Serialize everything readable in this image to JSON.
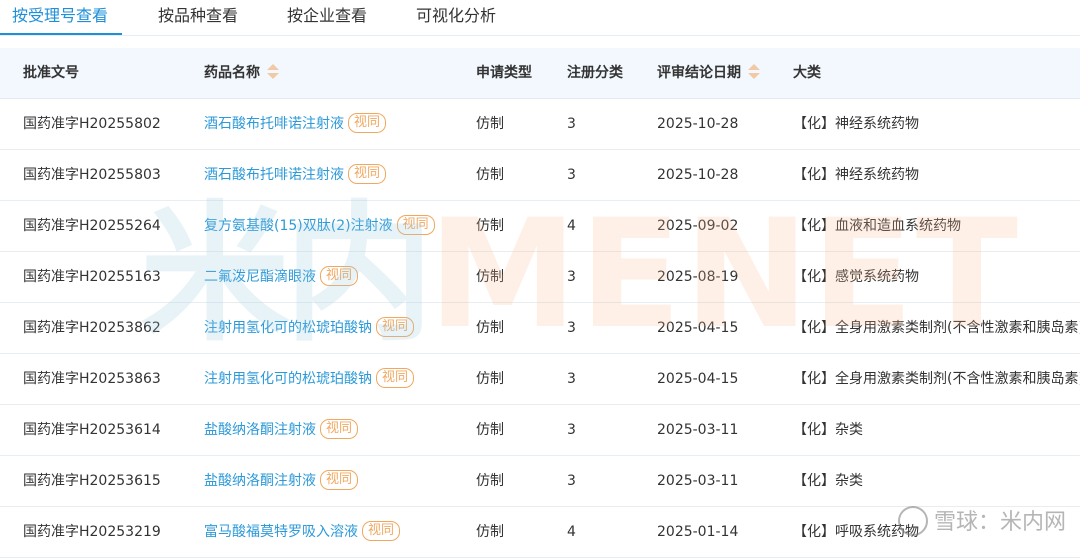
{
  "tabs": [
    {
      "label": "按受理号查看",
      "active": true
    },
    {
      "label": "按品种查看",
      "active": false
    },
    {
      "label": "按企业查看",
      "active": false
    },
    {
      "label": "可视化分析",
      "active": false
    }
  ],
  "table": {
    "headers": [
      "批准文号",
      "药品名称",
      "申请类型",
      "注册分类",
      "评审结论日期",
      "大类"
    ],
    "sortable_headers": [
      "药品名称",
      "评审结论日期"
    ],
    "badge_label": "视同",
    "rows": [
      {
        "approval_no": "国药准字H20255802",
        "drug_name": "酒石酸布托啡诺注射液",
        "app_type": "仿制",
        "reg_class": "3",
        "date": "2025-10-28",
        "category": "【化】神经系统药物"
      },
      {
        "approval_no": "国药准字H20255803",
        "drug_name": "酒石酸布托啡诺注射液",
        "app_type": "仿制",
        "reg_class": "3",
        "date": "2025-10-28",
        "category": "【化】神经系统药物"
      },
      {
        "approval_no": "国药准字H20255264",
        "drug_name": "复方氨基酸(15)双肽(2)注射液",
        "app_type": "仿制",
        "reg_class": "4",
        "date": "2025-09-02",
        "category": "【化】血液和造血系统药物"
      },
      {
        "approval_no": "国药准字H20255163",
        "drug_name": "二氟泼尼酯滴眼液",
        "app_type": "仿制",
        "reg_class": "3",
        "date": "2025-08-19",
        "category": "【化】感觉系统药物"
      },
      {
        "approval_no": "国药准字H20253862",
        "drug_name": "注射用氢化可的松琥珀酸钠",
        "app_type": "仿制",
        "reg_class": "3",
        "date": "2025-04-15",
        "category": "【化】全身用激素类制剂(不含性激素和胰岛素)"
      },
      {
        "approval_no": "国药准字H20253863",
        "drug_name": "注射用氢化可的松琥珀酸钠",
        "app_type": "仿制",
        "reg_class": "3",
        "date": "2025-04-15",
        "category": "【化】全身用激素类制剂(不含性激素和胰岛素)"
      },
      {
        "approval_no": "国药准字H20253614",
        "drug_name": "盐酸纳洛酮注射液",
        "app_type": "仿制",
        "reg_class": "3",
        "date": "2025-03-11",
        "category": "【化】杂类"
      },
      {
        "approval_no": "国药准字H20253615",
        "drug_name": "盐酸纳洛酮注射液",
        "app_type": "仿制",
        "reg_class": "3",
        "date": "2025-03-11",
        "category": "【化】杂类"
      },
      {
        "approval_no": "国药准字H20253219",
        "drug_name": "富马酸福莫特罗吸入溶液",
        "app_type": "仿制",
        "reg_class": "4",
        "date": "2025-01-14",
        "category": "【化】呼吸系统药物"
      }
    ]
  },
  "watermark": {
    "chinese": "米内",
    "english": "MENET"
  },
  "corner_watermark": "雪球：米内网",
  "colors": {
    "accent": "#1e8fd8",
    "link": "#2d9ad8",
    "badge": "#f0a860",
    "header_bg": "#f2f8fd"
  }
}
